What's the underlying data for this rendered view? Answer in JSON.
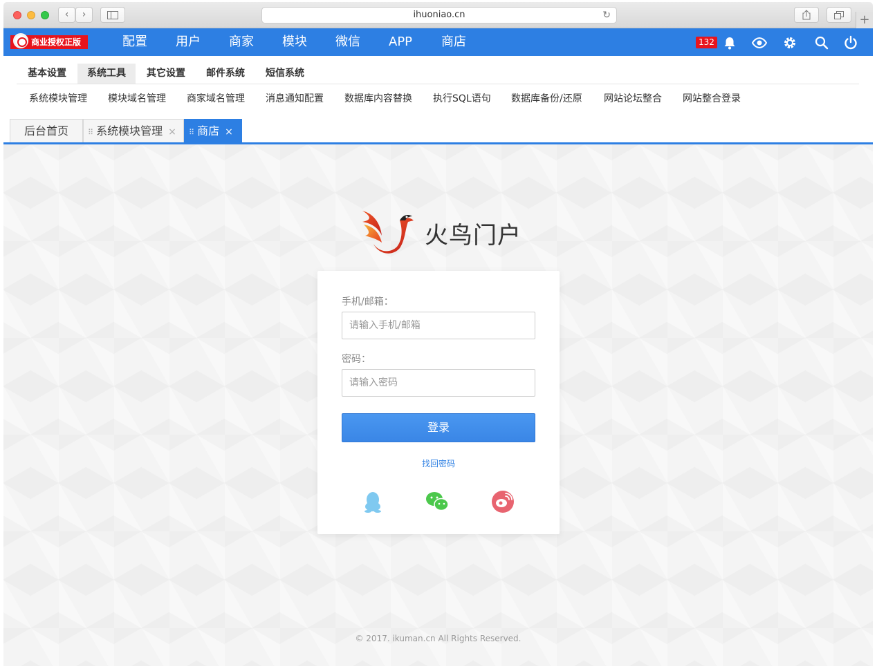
{
  "browser": {
    "url": "ihuoniao.cn"
  },
  "topnav": {
    "license_badge": "商业授权正版",
    "items": [
      "配置",
      "用户",
      "商家",
      "模块",
      "微信",
      "APP",
      "商店"
    ],
    "notification_count": "132"
  },
  "subnav": {
    "items": [
      "基本设置",
      "系统工具",
      "其它设置",
      "邮件系统",
      "短信系统"
    ],
    "active": "系统工具"
  },
  "thirdnav": {
    "items": [
      "系统模块管理",
      "模块域名管理",
      "商家域名管理",
      "消息通知配置",
      "数据库内容替换",
      "执行SQL语句",
      "数据库备份/还原",
      "网站论坛整合",
      "网站整合登录"
    ]
  },
  "tabs": [
    {
      "label": "后台首页",
      "closable": false
    },
    {
      "label": "系统模块管理",
      "closable": true
    },
    {
      "label": "商店",
      "closable": true,
      "active": true
    }
  ],
  "login": {
    "brand": "火鸟门户",
    "account_label": "手机/邮箱：",
    "account_placeholder": "请输入手机/邮箱",
    "password_label": "密码：",
    "password_placeholder": "请输入密码",
    "submit_label": "登录",
    "forgot_label": "找回密码",
    "social": [
      "qq-icon",
      "wechat-icon",
      "weibo-icon"
    ]
  },
  "footer": "© 2017. ikuman.cn All Rights Reserved.",
  "colors": {
    "primary": "#2d7fe3",
    "badge_red": "#e8141c",
    "qq": "#7fc9f0",
    "wechat": "#4cc84c",
    "weibo": "#e86470"
  }
}
